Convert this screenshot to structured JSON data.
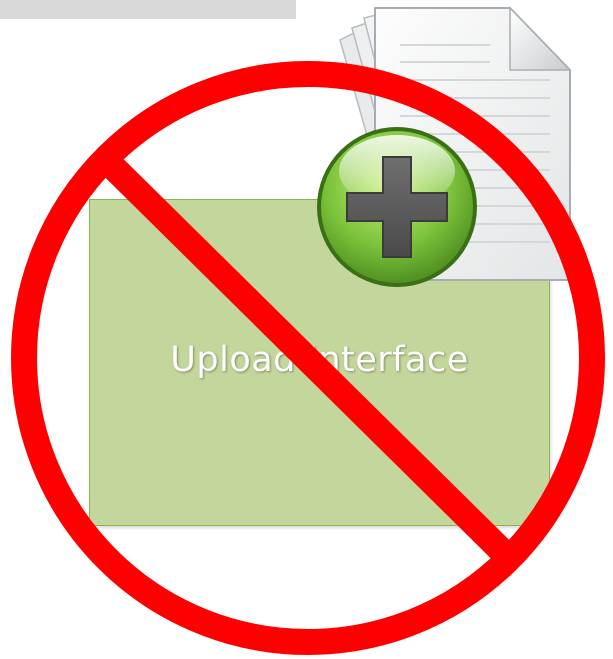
{
  "upload_box": {
    "label": "Upload Interface",
    "fill_color": "#c3d69b",
    "border_color": "#8db44f"
  },
  "icons": {
    "document": "document-stack-icon",
    "add": "plus-circle-icon",
    "prohibition": "no-symbol-icon"
  },
  "colors": {
    "prohibition_red": "#ff0000",
    "add_green": "#7cc23b",
    "top_bar": "#d9d9d9"
  }
}
